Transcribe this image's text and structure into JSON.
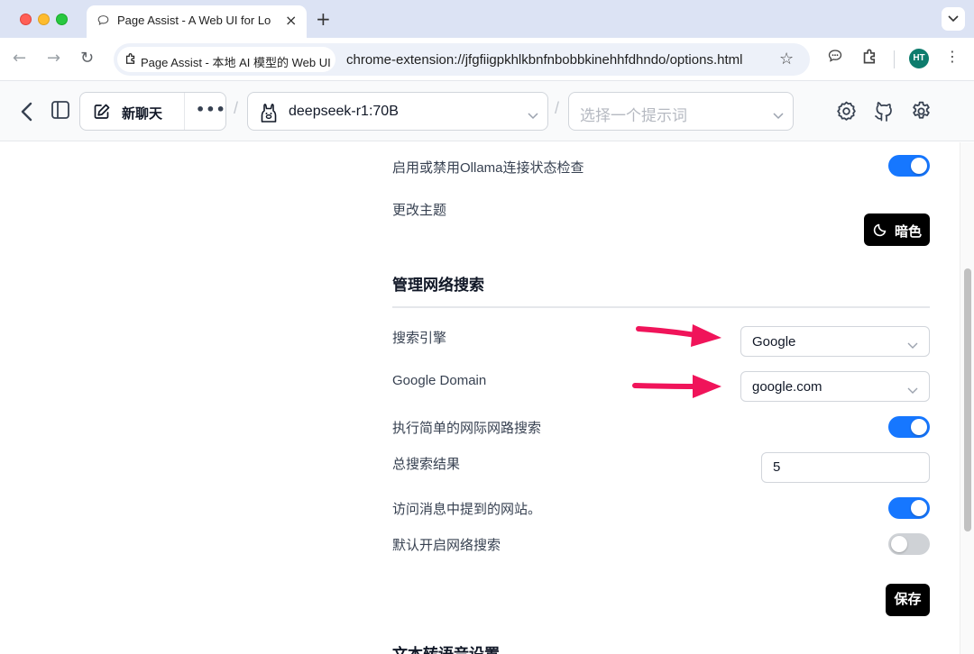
{
  "browser": {
    "tab_icon": "chat-bubble-icon",
    "tab_title": "Page Assist - A Web UI for Lo",
    "tab_close": "×",
    "new_tab": "+",
    "tab_menu": "⌄",
    "back": "←",
    "forward": "→",
    "reload": "↻",
    "site_chip": "Page Assist - 本地 AI 模型的 Web UI",
    "url": "chrome-extension://jfgfiigpkhlkbnfnbobbkinehhfdhndo/options.html",
    "star": "☆",
    "profile_initials": "HT",
    "menu": "⋮"
  },
  "header": {
    "new_chat": "新聊天",
    "more": "•••",
    "separator": "/",
    "model": "deepseek-r1:70B",
    "prompt_placeholder": "选择一个提示词"
  },
  "settings": {
    "ollama_check_label": "启用或禁用Ollama连接状态检查",
    "ollama_check_on": true,
    "theme_label": "更改主题",
    "theme_button": "暗色",
    "web_search_title": "管理网络搜索",
    "search_engine_label": "搜索引擎",
    "search_engine_value": "Google",
    "google_domain_label": "Google Domain",
    "google_domain_value": "google.com",
    "simple_search_label": "执行简单的网际网路搜索",
    "simple_search_on": true,
    "total_results_label": "总搜索结果",
    "total_results_value": "5",
    "visit_sites_label": "访问消息中提到的网站。",
    "visit_sites_on": true,
    "default_search_label": "默认开启网络搜索",
    "default_search_on": false,
    "save_button": "保存",
    "tts_title": "文本转语音设置"
  },
  "colors": {
    "toggle_on": "#1677ff",
    "toggle_off": "#cfd2d6",
    "annotation_arrow": "#f0145a"
  }
}
